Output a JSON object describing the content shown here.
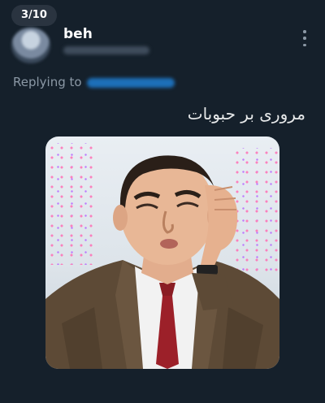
{
  "thread": {
    "counter": "3/10"
  },
  "post": {
    "author_name": "beh",
    "replying_prefix": "Replying to",
    "text": "مروری بر حبوبات"
  },
  "media": {
    "description_icon": "photo-icon"
  },
  "colors": {
    "background": "#15202b",
    "text_primary": "#e7e9ea",
    "text_secondary": "#8b98a5",
    "link": "#1d9bf0"
  }
}
